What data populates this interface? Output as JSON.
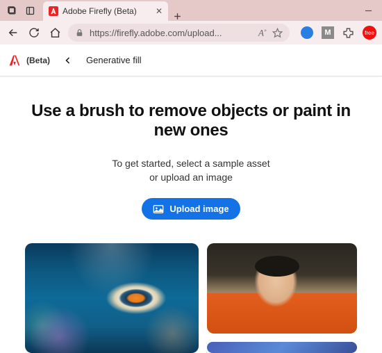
{
  "browser": {
    "tab_title": "Adobe Firefly (Beta)",
    "url": "https://firefly.adobe.com/upload...",
    "reader_label": "A",
    "ext_label": "M",
    "avatar_text": "free"
  },
  "app": {
    "beta_label": "(Beta)",
    "breadcrumb": "Generative fill"
  },
  "hero": {
    "title": "Use a brush to remove objects or paint in new ones",
    "sub_line1": "To get started, select a sample asset",
    "sub_line2": "or upload an image",
    "upload_label": "Upload image"
  }
}
